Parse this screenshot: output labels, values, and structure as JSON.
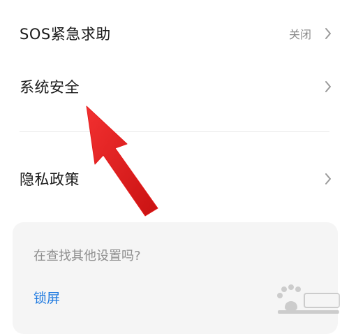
{
  "settings": {
    "items": [
      {
        "label": "SOS紧急求助",
        "value": "关闭"
      },
      {
        "label": "系统安全",
        "value": ""
      },
      {
        "label": "隐私政策",
        "value": ""
      }
    ]
  },
  "search_card": {
    "question": "在查找其他设置吗?",
    "link": "锁屏"
  },
  "colors": {
    "arrow": "#e51b1b",
    "link": "#1f7ae0",
    "card_background": "#f5f5f5"
  },
  "icons": {
    "chevron": "chevron-right-icon",
    "watermark": "baidu-watermark-icon"
  }
}
